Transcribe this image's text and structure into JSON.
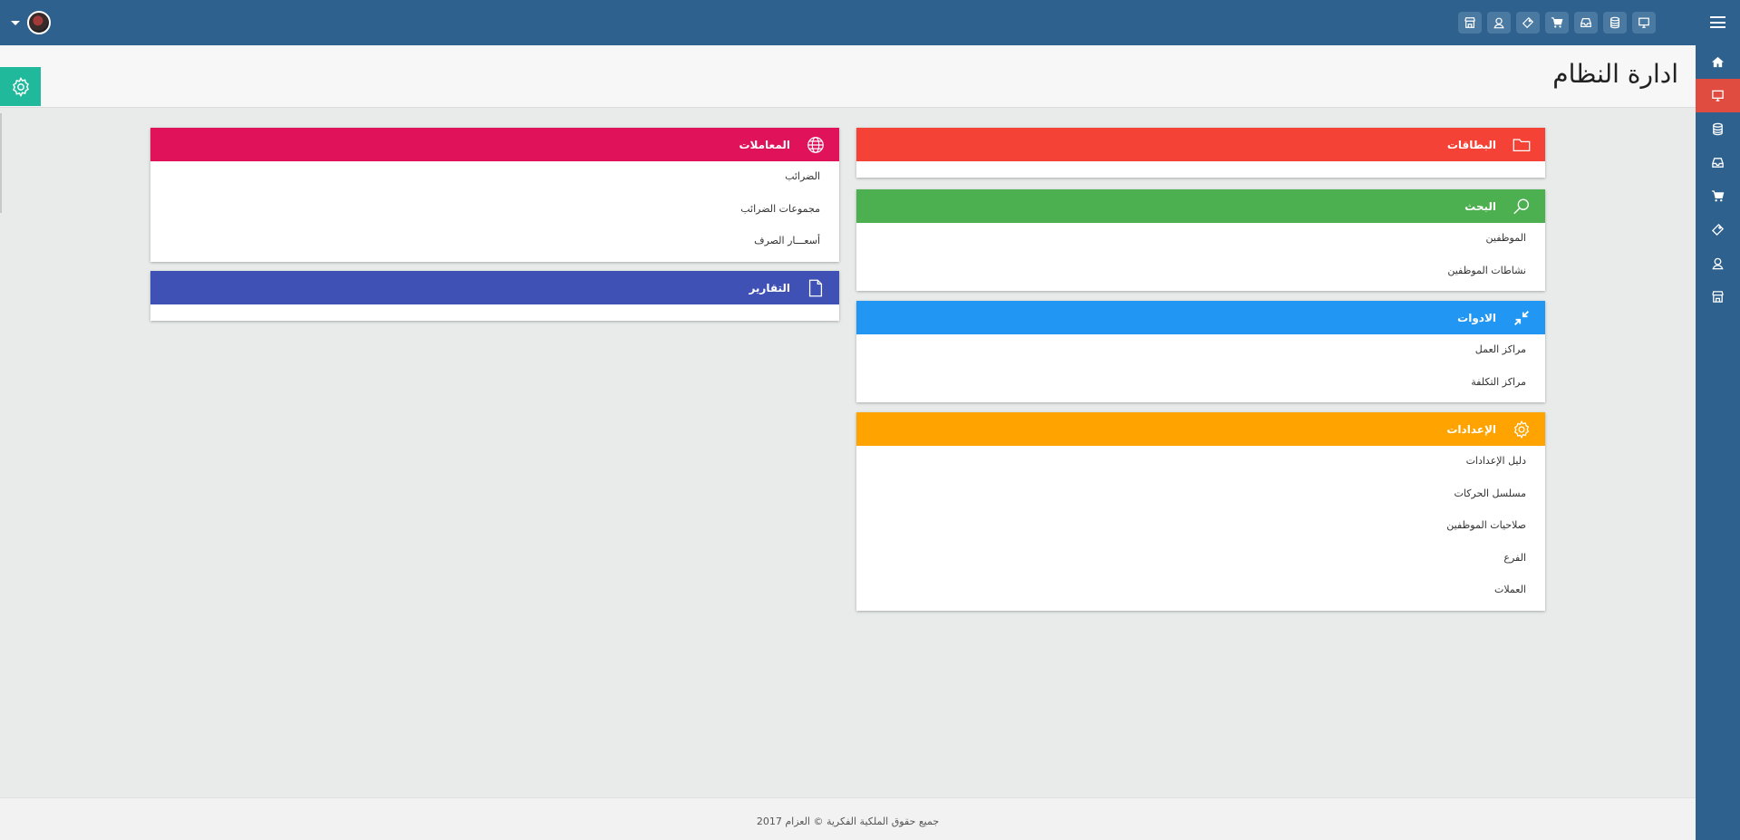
{
  "page": {
    "title": "ادارة النظام"
  },
  "footer": {
    "copyright": "جميع حقوق الملكية الفكرية © العزام 2017"
  },
  "top_icons": [
    "store-icon",
    "user-icon",
    "tag-icon",
    "cart-icon",
    "inbox-icon",
    "database-icon",
    "monitor-icon"
  ],
  "sidebar_items": [
    "home-icon",
    "monitor-icon",
    "database-icon",
    "inbox-icon",
    "cart-icon",
    "tag-icon",
    "user-icon",
    "store-icon"
  ],
  "colors": {
    "topbar": "#2e618d",
    "sidebar_active": "#e04c3f",
    "settings_button": "#20b99b",
    "cards": "#f44336",
    "search": "#4caf50",
    "tools": "#2196f3",
    "settings": "#ffa300",
    "transactions": "#e0125a",
    "reports": "#3f51b5"
  },
  "panels": {
    "cards": {
      "title": "البطاقات",
      "icon": "folder-icon",
      "links": []
    },
    "search": {
      "title": "البحث",
      "icon": "search-icon",
      "links": [
        "الموظفين",
        "نشاطات الموظفين"
      ]
    },
    "tools": {
      "title": "الادوات",
      "icon": "collapse-arrows-icon",
      "links": [
        "مراكز العمل",
        "مراكز التكلفة"
      ]
    },
    "settings": {
      "title": "الإعدادات",
      "icon": "gear-icon",
      "links": [
        "دليل الإعدادات",
        "مسلسل الحركات",
        "صلاحيات الموظفين",
        "الفرع",
        "العملات"
      ]
    },
    "transactions": {
      "title": "المعاملات",
      "icon": "globe-icon",
      "links": [
        "الضرائب",
        "مجموعات الضرائب",
        "أسعـــار الصرف"
      ]
    },
    "reports": {
      "title": "التقارير",
      "icon": "document-icon",
      "links": []
    }
  }
}
